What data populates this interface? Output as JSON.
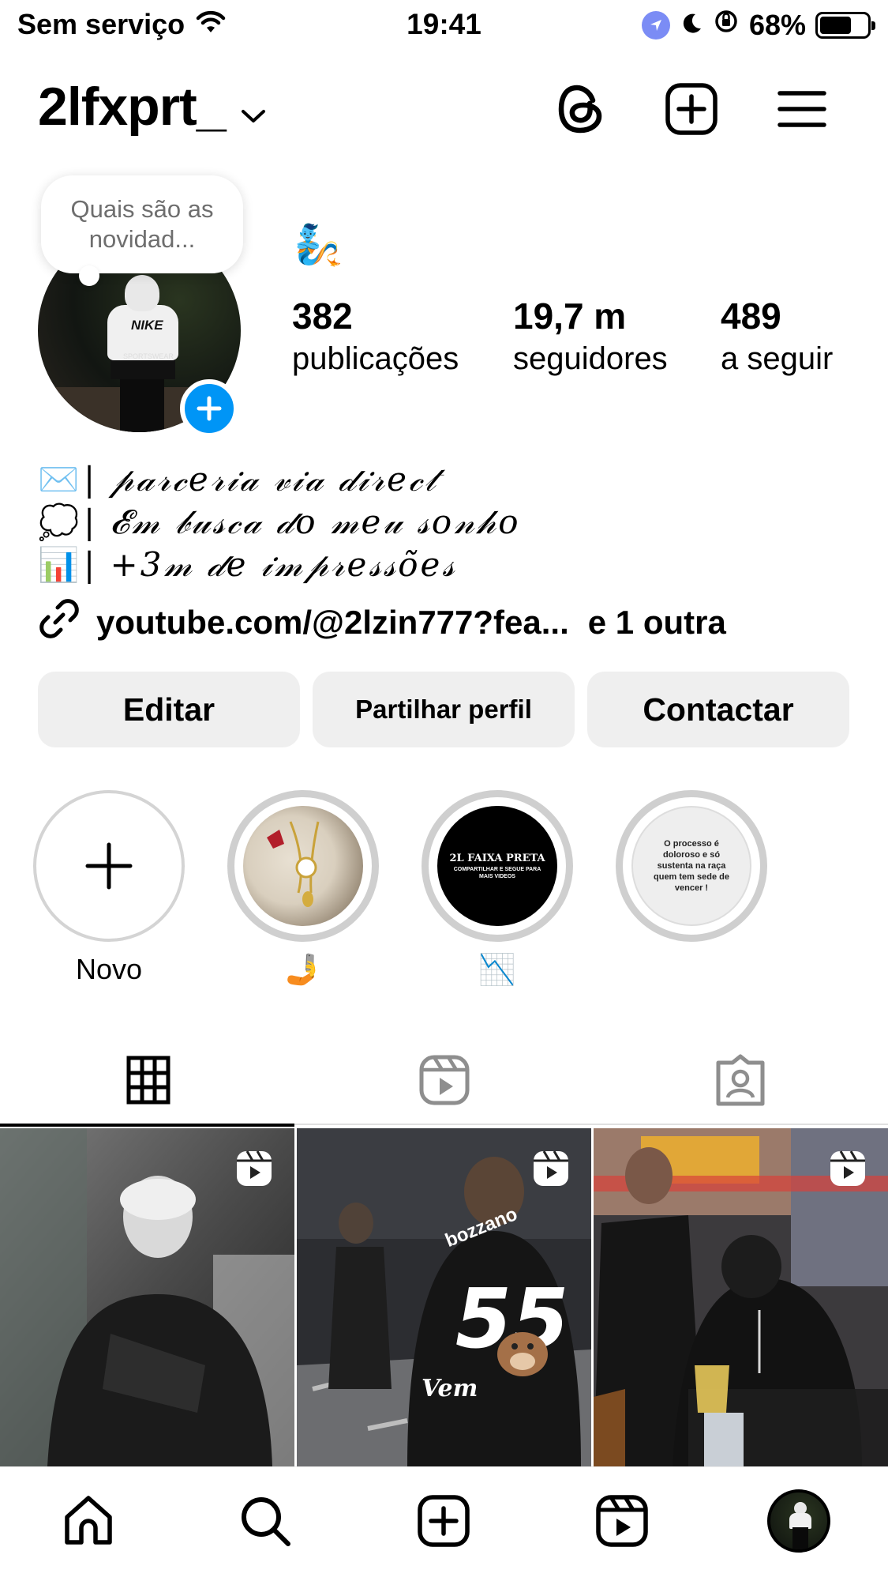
{
  "status_bar": {
    "carrier": "Sem serviço",
    "time": "19:41",
    "battery_percent": "68%",
    "battery_level": 0.68,
    "icons": [
      "wifi-icon",
      "location-icon",
      "moon-icon",
      "orientation-lock-icon",
      "battery-icon"
    ]
  },
  "header": {
    "username": "2lfxprt_",
    "icons": [
      "chevron-down-icon",
      "threads-icon",
      "add-post-icon",
      "menu-icon"
    ]
  },
  "profile": {
    "note": "Quais são as novidad...",
    "note_emoji": "🧞",
    "stats": [
      {
        "number": "382",
        "label": "publicações"
      },
      {
        "number": "19,7 m",
        "label": "seguidores"
      },
      {
        "number": "489",
        "label": "a seguir"
      }
    ]
  },
  "bio": {
    "lines": [
      {
        "emoji": "✉️",
        "text": "| 𝓅𝒶𝓇𝒸𝑒𝓇𝒾𝒶 𝓋𝒾𝒶 𝒹𝒾𝓇𝑒𝒸𝓉"
      },
      {
        "emoji": "💭",
        "text": "| 𝓔𝓂 𝒷𝓊𝓈𝒸𝒶 𝒹𝑜 𝓂𝑒𝓊 𝓈𝑜𝓃𝒽𝑜"
      },
      {
        "emoji": "📊",
        "text": "| +3𝓂 𝒹𝑒 𝒾𝓂𝓅𝓇𝑒𝓈𝓈õ𝑒𝓈"
      }
    ],
    "link": "youtube.com/@2lzin777?fea...",
    "link_more": "e 1 outra"
  },
  "buttons": {
    "edit": "Editar",
    "share": "Partilhar perfil",
    "contact": "Contactar"
  },
  "highlights": [
    {
      "label": "Novo",
      "emoji": ""
    },
    {
      "label": "",
      "emoji": "🤳"
    },
    {
      "label": "",
      "emoji": "📉"
    },
    {
      "label": "",
      "emoji": ""
    }
  ],
  "highlight_texts": {
    "h3_line1": "2L FAIXA PRETA",
    "h3_line2": "COMPARTILHAR E SEGUE PARA",
    "h3_line3": "MAIS VIDEOS",
    "h4": "O processo é doloroso e só sustenta na raça quem tem sede de vencer !"
  },
  "tabs": [
    "grid-tab",
    "reels-tab",
    "tagged-tab"
  ],
  "grid_posts": [
    {
      "caption": ""
    },
    {
      "caption": "Vem",
      "jersey_number": "55",
      "sponsor": "bozzano"
    },
    {
      "caption": ""
    }
  ],
  "bottom_nav": [
    "home",
    "search",
    "create",
    "reels",
    "profile"
  ]
}
